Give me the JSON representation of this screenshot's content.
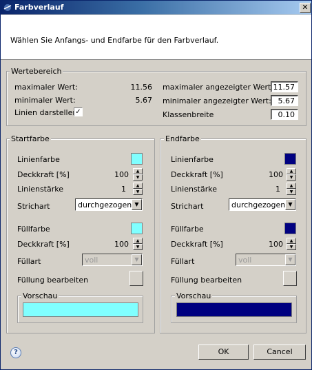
{
  "window": {
    "title": "Farbverlauf",
    "close_icon": "close-icon"
  },
  "banner": {
    "message": "Wählen Sie Anfangs- und Endfarbe für den Farbverlauf."
  },
  "range": {
    "legend": "Wertebereich",
    "max_label": "maximaler Wert:",
    "max_value": "11.56",
    "min_label": "minimaler Wert:",
    "min_value": "5.67",
    "lines_label": "Linien darstellen:",
    "lines_checked": "✓",
    "max_shown_label": "maximaler angezeigter Wert:",
    "max_shown_value": "11.57",
    "min_shown_label": "minimaler angezeigter Wert:",
    "min_shown_value": "5.67",
    "class_width_label": "Klassenbreite",
    "class_width_value": "0.10"
  },
  "start": {
    "legend": "Startfarbe",
    "line_color_label": "Linienfarbe",
    "line_color": "#80ffff",
    "opacity_label": "Deckkraft [%]",
    "opacity_value": "100",
    "line_width_label": "Linienstärke",
    "line_width_value": "1",
    "line_style_label": "Strichart",
    "line_style_value": "durchgezogen",
    "fill_color_label": "Füllfarbe",
    "fill_color": "#80ffff",
    "fill_opacity_label": "Deckkraft [%]",
    "fill_opacity_value": "100",
    "fill_type_label": "Füllart",
    "fill_type_value": "voll",
    "edit_fill_label": "Füllung bearbeiten",
    "preview_legend": "Vorschau",
    "preview_color": "#80ffff"
  },
  "end": {
    "legend": "Endfarbe",
    "line_color_label": "Linienfarbe",
    "line_color": "#000080",
    "opacity_label": "Deckkraft [%]",
    "opacity_value": "100",
    "line_width_label": "Linienstärke",
    "line_width_value": "1",
    "line_style_label": "Strichart",
    "line_style_value": "durchgezogen",
    "fill_color_label": "Füllfarbe",
    "fill_color": "#000080",
    "fill_opacity_label": "Deckkraft [%]",
    "fill_opacity_value": "100",
    "fill_type_label": "Füllart",
    "fill_type_value": "voll",
    "edit_fill_label": "Füllung bearbeiten",
    "preview_legend": "Vorschau",
    "preview_color": "#000080"
  },
  "footer": {
    "help_icon": "help-icon",
    "ok_label": "OK",
    "cancel_label": "Cancel"
  }
}
